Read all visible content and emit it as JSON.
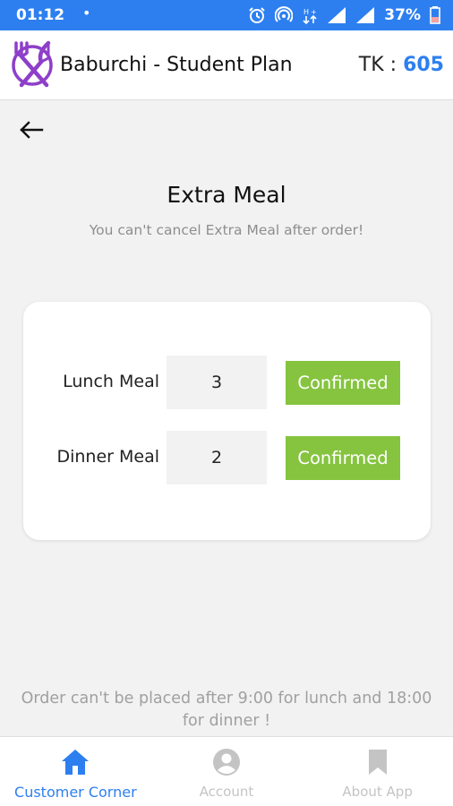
{
  "status_bar": {
    "time": "01:12",
    "dot": "•",
    "battery": "37%",
    "icons": [
      "alarm-icon",
      "hotspot-icon",
      "data-icon",
      "signal-icon",
      "signal-icon",
      "battery-icon"
    ]
  },
  "app_bar": {
    "title": "Baburchi - Student Plan",
    "balance_label": "TK : ",
    "balance_value": "605",
    "logo": "utensils-logo"
  },
  "page": {
    "title": "Extra Meal",
    "subtitle": "You can't cancel Extra Meal after order!"
  },
  "meals": [
    {
      "label": "Lunch Meal",
      "quantity": "3",
      "status": "Confirmed"
    },
    {
      "label": "Dinner Meal",
      "quantity": "2",
      "status": "Confirmed"
    }
  ],
  "notice": "Order can't be placed after 9:00 for lunch and 18:00 for dinner !",
  "bottom_nav": [
    {
      "label": "Customer Corner",
      "icon": "home-icon",
      "active": true
    },
    {
      "label": "Account",
      "icon": "account-icon",
      "active": false
    },
    {
      "label": "About App",
      "icon": "bookmark-icon",
      "active": false
    }
  ],
  "colors": {
    "primary": "#2d7ff0",
    "confirm": "#86c440",
    "logo": "#8e3fc9"
  }
}
